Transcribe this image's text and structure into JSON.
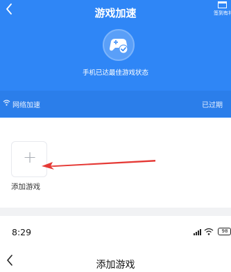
{
  "top_header": {
    "back_icon": "chevron-left-icon",
    "title": "游戏加速",
    "gift_label": "签到有礼"
  },
  "hero": {
    "icon": "gamepad-check-icon",
    "status_text": "手机已达最佳游戏状态"
  },
  "network_bar": {
    "icon": "wifi-icon",
    "label": "网络加速",
    "status": "已过期"
  },
  "game_list": {
    "add_button_icon": "plus-icon",
    "add_label": "添加游戏",
    "annotation": "red-arrow-pointing-left"
  },
  "status_bar": {
    "time": "8:29",
    "battery": "98"
  },
  "bottom_header": {
    "back_icon": "chevron-left-icon",
    "title": "添加游戏"
  },
  "colors": {
    "primary_blue": "#2f86f6",
    "arrow_red": "#e53935"
  }
}
